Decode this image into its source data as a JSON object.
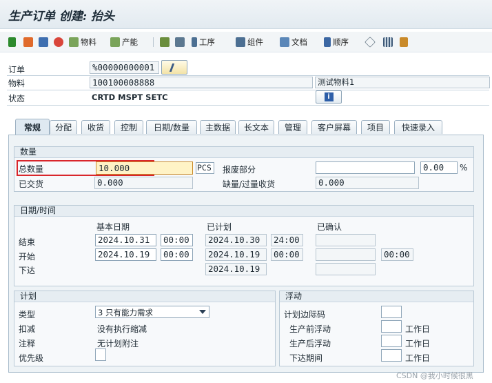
{
  "title": "生产订单 创建: 抬头",
  "toolbar": {
    "items": [
      "物料",
      "产能",
      "工序",
      "组件",
      "文档",
      "顺序"
    ]
  },
  "header": {
    "order_label": "订单",
    "order_value": "%00000000001",
    "material_label": "物料",
    "material_value": "100100008888",
    "material_desc": "测试物料1",
    "status_label": "状态",
    "status_value": "CRTD MSPT SETC",
    "info_icon_text": "i"
  },
  "tabs": [
    "常规",
    "分配",
    "收货",
    "控制",
    "日期/数量",
    "主数据",
    "长文本",
    "管理",
    "客户屏幕",
    "项目",
    "快速录入"
  ],
  "quantity": {
    "group_title": "数量",
    "total_label": "总数量",
    "total_value": "10.000",
    "unit": "PCS",
    "scrap_label": "报废部分",
    "scrap_value": "",
    "scrap_pct": "0.00",
    "pct_sign": "%",
    "delivered_label": "已交货",
    "delivered_value": "0.000",
    "short_label": "缺量/过量收货",
    "short_value": "0.000"
  },
  "dates": {
    "group_title": "日期/时间",
    "col_basic": "基本日期",
    "col_planned": "已计划",
    "col_confirmed": "已确认",
    "end_label": "结束",
    "end_basic_date": "2024.10.31",
    "end_basic_time": "00:00",
    "end_plan_date": "2024.10.30",
    "end_plan_time": "24:00",
    "start_label": "开始",
    "start_basic_date": "2024.10.19",
    "start_basic_time": "00:00",
    "start_plan_date": "2024.10.19",
    "start_plan_time": "00:00",
    "start_conf_time": "00:00",
    "release_label": "下达",
    "release_plan_date": "2024.10.19"
  },
  "planning": {
    "group_title": "计划",
    "type_label": "类型",
    "type_value": "3 只有能力需求",
    "reduce_label": "扣减",
    "reduce_value": "没有执行缩减",
    "note_label": "注释",
    "note_value": "无计划附注",
    "priority_label": "优先级"
  },
  "float": {
    "group_title": "浮动",
    "margin_label": "计划边际码",
    "pre_label": "生产前浮动",
    "post_label": "生产后浮动",
    "release_label": "下达期间",
    "unit": "工作日"
  },
  "watermark": "CSDN @我小时候很黑",
  "colors": {
    "highlight_border": "#d9262b",
    "active_field": "#fff3c6",
    "green_flag": "#2d8a2d"
  }
}
